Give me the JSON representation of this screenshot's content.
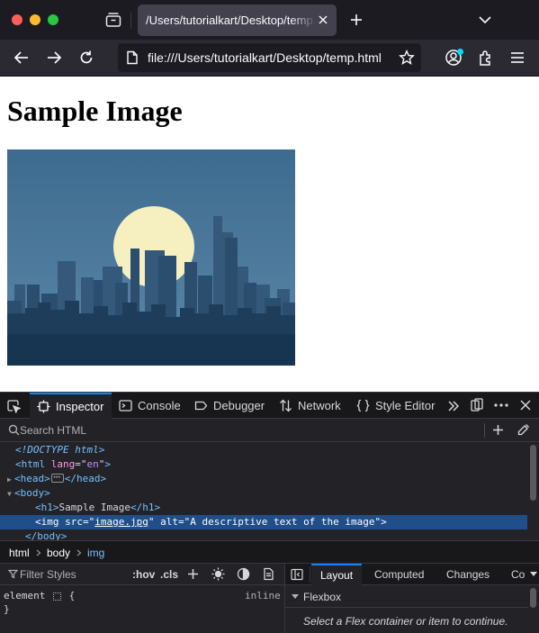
{
  "browser": {
    "tab_title": "/Users/tutorialkart/Desktop/temp.html",
    "url": "file:///Users/tutorialkart/Desktop/temp.html"
  },
  "page": {
    "heading": "Sample Image",
    "image_alt": "A descriptive text of the image"
  },
  "devtools": {
    "tabs": [
      "Inspector",
      "Console",
      "Debugger",
      "Network",
      "Style Editor"
    ],
    "active_tab": "Inspector",
    "search_placeholder": "Search HTML",
    "markup": {
      "doctype": "<!DOCTYPE html>",
      "html_tag": "html",
      "lang_attr": "lang",
      "lang_val": "en",
      "head_tag": "head",
      "body_tag": "body",
      "h1_tag": "h1",
      "h1_text": "Sample Image",
      "img_tag": "img",
      "src_attr": "src",
      "src_val": "image.jpg",
      "alt_attr": "alt",
      "alt_val": "A descriptive text of the image"
    },
    "breadcrumbs": [
      "html",
      "body",
      "img"
    ],
    "rules": {
      "filter_placeholder": "Filter Styles",
      "hov": ":hov",
      "cls": ".cls",
      "selector": "element",
      "open_brace": "{",
      "close_brace": "}",
      "origin": "inline"
    },
    "sidebar": {
      "tabs": [
        "Layout",
        "Computed",
        "Changes",
        "Co"
      ],
      "active_tab": "Layout",
      "flexbox_heading": "Flexbox",
      "flexbox_message": "Select a Flex container or item to continue."
    }
  },
  "colors": {
    "accent": "#0a84ff",
    "selection": "#204e8a",
    "tag": "#75bfff",
    "attribute": "#ff97e5",
    "value": "#b98eff"
  },
  "icons": {
    "titlebar": [
      "tab-overview-icon",
      "close-icon",
      "plus-icon",
      "chevron-down-icon"
    ],
    "nav": [
      "back-arrow-icon",
      "forward-arrow-icon",
      "reload-icon",
      "page-icon",
      "star-icon",
      "account-icon",
      "extensions-icon",
      "hamburger-menu-icon"
    ],
    "devtools": [
      "element-picker-icon",
      "overflow-chevrons-icon",
      "dock-icon",
      "more-options-icon",
      "close-icon",
      "search-icon",
      "plus-icon",
      "eyedropper-icon",
      "filter-icon",
      "light-mode-icon",
      "contrast-icon",
      "print-icon"
    ]
  }
}
